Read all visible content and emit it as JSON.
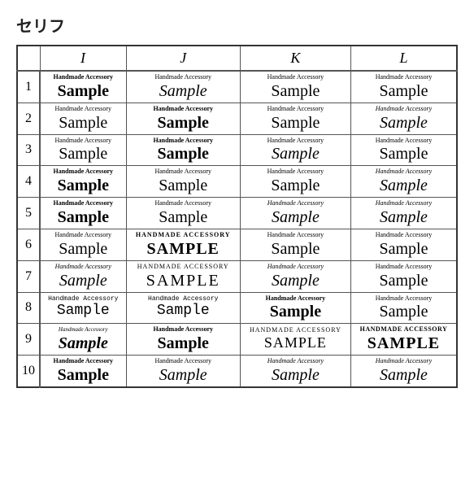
{
  "title": "セリフ",
  "table": {
    "col_headers": [
      "",
      "I",
      "J",
      "K",
      "L"
    ],
    "rows": [
      {
        "num": "1",
        "cells": [
          {
            "top": "Handmade Accessory",
            "bottom": "Sample",
            "style": "r1c1"
          },
          {
            "top": "Handmade Accessory",
            "bottom": "Sample",
            "style": "r1c2"
          },
          {
            "top": "Handmade Accessory",
            "bottom": "Sample",
            "style": "r1c3"
          },
          {
            "top": "Handmade Accessory",
            "bottom": "Sample",
            "style": "r1c4"
          }
        ]
      },
      {
        "num": "2",
        "cells": [
          {
            "top": "Handmade Accessory",
            "bottom": "Sample",
            "style": "r2c1"
          },
          {
            "top": "Handmade Accessory",
            "bottom": "Sample",
            "style": "r2c2"
          },
          {
            "top": "Handmade Accessory",
            "bottom": "Sample",
            "style": "r2c3"
          },
          {
            "top": "Handmade Accessory",
            "bottom": "Sample",
            "style": "r2c4"
          }
        ]
      },
      {
        "num": "3",
        "cells": [
          {
            "top": "Handmade Accessory",
            "bottom": "Sample",
            "style": "r3c1"
          },
          {
            "top": "Handmade Accessory",
            "bottom": "Sample",
            "style": "r3c2"
          },
          {
            "top": "Handmade Accessory",
            "bottom": "Sample",
            "style": "r3c3"
          },
          {
            "top": "Handmade Accessory",
            "bottom": "Sample",
            "style": "r3c4"
          }
        ]
      },
      {
        "num": "4",
        "cells": [
          {
            "top": "Handmade Accessory",
            "bottom": "Sample",
            "style": "r4c1"
          },
          {
            "top": "Handmade Accessory",
            "bottom": "Sample",
            "style": "r4c2"
          },
          {
            "top": "Handmade Accessory",
            "bottom": "Sample",
            "style": "r4c3"
          },
          {
            "top": "Handmade Accessory",
            "bottom": "Sample",
            "style": "r4c4"
          }
        ]
      },
      {
        "num": "5",
        "cells": [
          {
            "top": "Handmade Accessory",
            "bottom": "Sample",
            "style": "r5c1"
          },
          {
            "top": "Handmade Accessory",
            "bottom": "Sample",
            "style": "r5c2"
          },
          {
            "top": "Handmade Accessory",
            "bottom": "Sample",
            "style": "r5c3"
          },
          {
            "top": "Handmade Accessory",
            "bottom": "Sample",
            "style": "r5c4"
          }
        ]
      },
      {
        "num": "6",
        "cells": [
          {
            "top": "Handmade Accessory",
            "bottom": "Sample",
            "style": "r6c1"
          },
          {
            "top": "HANDMADE ACCESSORY",
            "bottom": "SAMPLE",
            "style": "r6c2"
          },
          {
            "top": "Handmade Accessory",
            "bottom": "Sample",
            "style": "r6c3"
          },
          {
            "top": "Handmade Accessory",
            "bottom": "Sample",
            "style": "r6c4"
          }
        ]
      },
      {
        "num": "7",
        "cells": [
          {
            "top": "Handmade Accessory",
            "bottom": "Sample",
            "style": "r7c1"
          },
          {
            "top": "HANDMADE ACCESSORY",
            "bottom": "SAMPLE",
            "style": "r7c2"
          },
          {
            "top": "Handmade Accessory",
            "bottom": "Sample",
            "style": "r7c3"
          },
          {
            "top": "Handmade Accessory",
            "bottom": "Sample",
            "style": "r7c4"
          }
        ]
      },
      {
        "num": "8",
        "cells": [
          {
            "top": "Handmade Accessory",
            "bottom": "Sample",
            "style": "r8c1"
          },
          {
            "top": "Handmade Accessory",
            "bottom": "Sample",
            "style": "r8c2"
          },
          {
            "top": "Handmade Accessory",
            "bottom": "Sample",
            "style": "r8c3"
          },
          {
            "top": "Handmade Accessory",
            "bottom": "Sample",
            "style": "r8c4"
          }
        ]
      },
      {
        "num": "9",
        "cells": [
          {
            "top": "Handmade Accessory",
            "bottom": "Sample",
            "style": "r9c1"
          },
          {
            "top": "Handmade Accessory",
            "bottom": "Sample",
            "style": "r9c2"
          },
          {
            "top": "HANDMADE ACCESSORY",
            "bottom": "SAMPLE",
            "style": "r9c3"
          },
          {
            "top": "HANDMADE ACCESSORY",
            "bottom": "SAMPLE",
            "style": "r9c4"
          }
        ]
      },
      {
        "num": "10",
        "cells": [
          {
            "top": "Handmade Accessory",
            "bottom": "Sample",
            "style": "r10c1"
          },
          {
            "top": "Handmade Accessory",
            "bottom": "Sample",
            "style": "r10c2"
          },
          {
            "top": "Handmade Accessory",
            "bottom": "Sample",
            "style": "r10c3"
          },
          {
            "top": "Handmade Accessory",
            "bottom": "Sample",
            "style": "r10c4"
          }
        ]
      }
    ]
  }
}
